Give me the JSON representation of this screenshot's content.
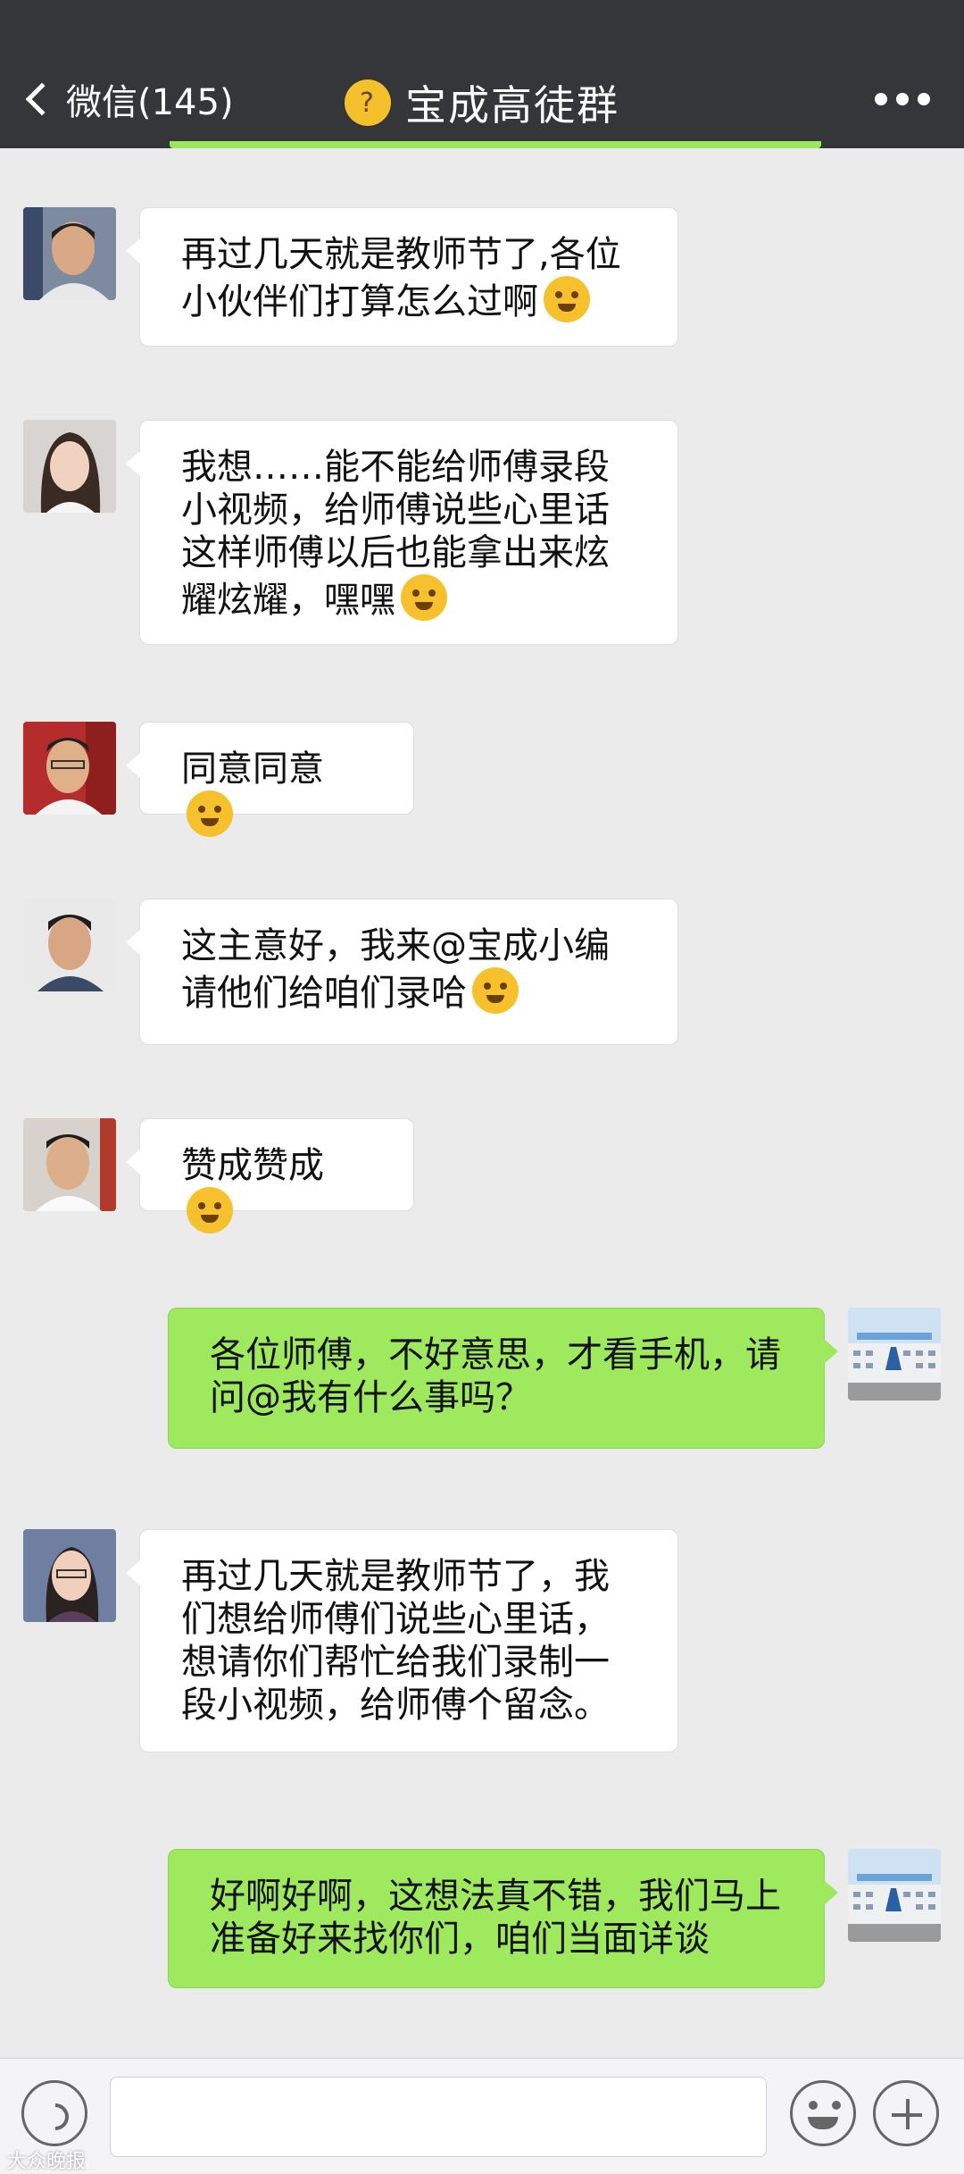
{
  "header": {
    "back_label": "微信(145)",
    "title": "宝成高徒群",
    "title_emoji": "thinking-face-emoji",
    "more_icon": "more-dots-icon"
  },
  "messages": [
    {
      "side": "left",
      "avatar": "member-avatar-1",
      "text": "再过几天就是教师节了,各位小伙伴们打算怎么过啊",
      "emoji": "dizzy-face-emoji"
    },
    {
      "side": "left",
      "avatar": "member-avatar-2",
      "text": "我想……能不能给师傅录段小视频，给师傅说些心里话这样师傅以后也能拿出来炫耀炫耀，嘿嘿",
      "emoji": "grinning-emoji"
    },
    {
      "side": "left",
      "avatar": "member-avatar-3",
      "text": "同意同意",
      "emoji": "smiling-emoji"
    },
    {
      "side": "left",
      "avatar": "member-avatar-4",
      "text": "这主意好，我来@宝成小编请他们给咱们录哈",
      "emoji": "pleading-emoji"
    },
    {
      "side": "left",
      "avatar": "member-avatar-5",
      "text": "赞成赞成",
      "emoji": "smiling-emoji"
    },
    {
      "side": "right",
      "avatar": "self-avatar",
      "text": "各位师傅，不好意思，才看手机，请问@我有什么事吗？"
    },
    {
      "side": "left",
      "avatar": "member-avatar-6",
      "text": "再过几天就是教师节了，我们想给师傅们说些心里话，想请你们帮忙给我们录制一段小视频，给师傅个留念。"
    },
    {
      "side": "right",
      "avatar": "self-avatar",
      "text": "好啊好啊，这想法真不错，我们马上准备好来找你们，咱们当面详谈"
    }
  ],
  "input_bar": {
    "voice_icon": "voice-icon",
    "emoji_icon": "emoji-icon",
    "plus_icon": "plus-icon",
    "placeholder": ""
  },
  "watermark": "大众晚报",
  "colors": {
    "header_bg": "#34363a",
    "chat_bg": "#ebebeb",
    "sent_bubble": "#9ee95e",
    "received_bubble": "#ffffff"
  }
}
